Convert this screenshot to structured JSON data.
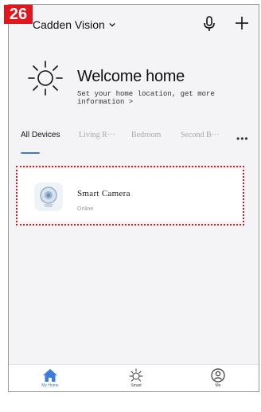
{
  "step_badge": "26",
  "header": {
    "home_name": "Cadden Vision",
    "icons": [
      "chevron-down-icon",
      "microphone-icon",
      "plus-icon"
    ]
  },
  "welcome": {
    "icon": "sun-icon",
    "title": "Welcome home",
    "subtitle": "Set your home location, get more information >"
  },
  "tabs": [
    {
      "label": "All Devices",
      "active": true
    },
    {
      "label": "Living R···",
      "active": false
    },
    {
      "label": "Bedroom",
      "active": false
    },
    {
      "label": "Second B···",
      "active": false
    }
  ],
  "more_label": "•••",
  "devices": [
    {
      "name": "Smart  Camera",
      "status": "Online",
      "icon": "camera-icon"
    }
  ],
  "bottom_nav": [
    {
      "label": "My Home",
      "icon": "home-icon",
      "active": true
    },
    {
      "label": "Smart",
      "icon": "sun-icon",
      "active": false
    },
    {
      "label": "Me",
      "icon": "user-icon",
      "active": false
    }
  ],
  "colors": {
    "accent": "#3a7ddd",
    "highlight": "#e1141c",
    "badge": "#e4161d",
    "background": "#f4f4f6"
  }
}
